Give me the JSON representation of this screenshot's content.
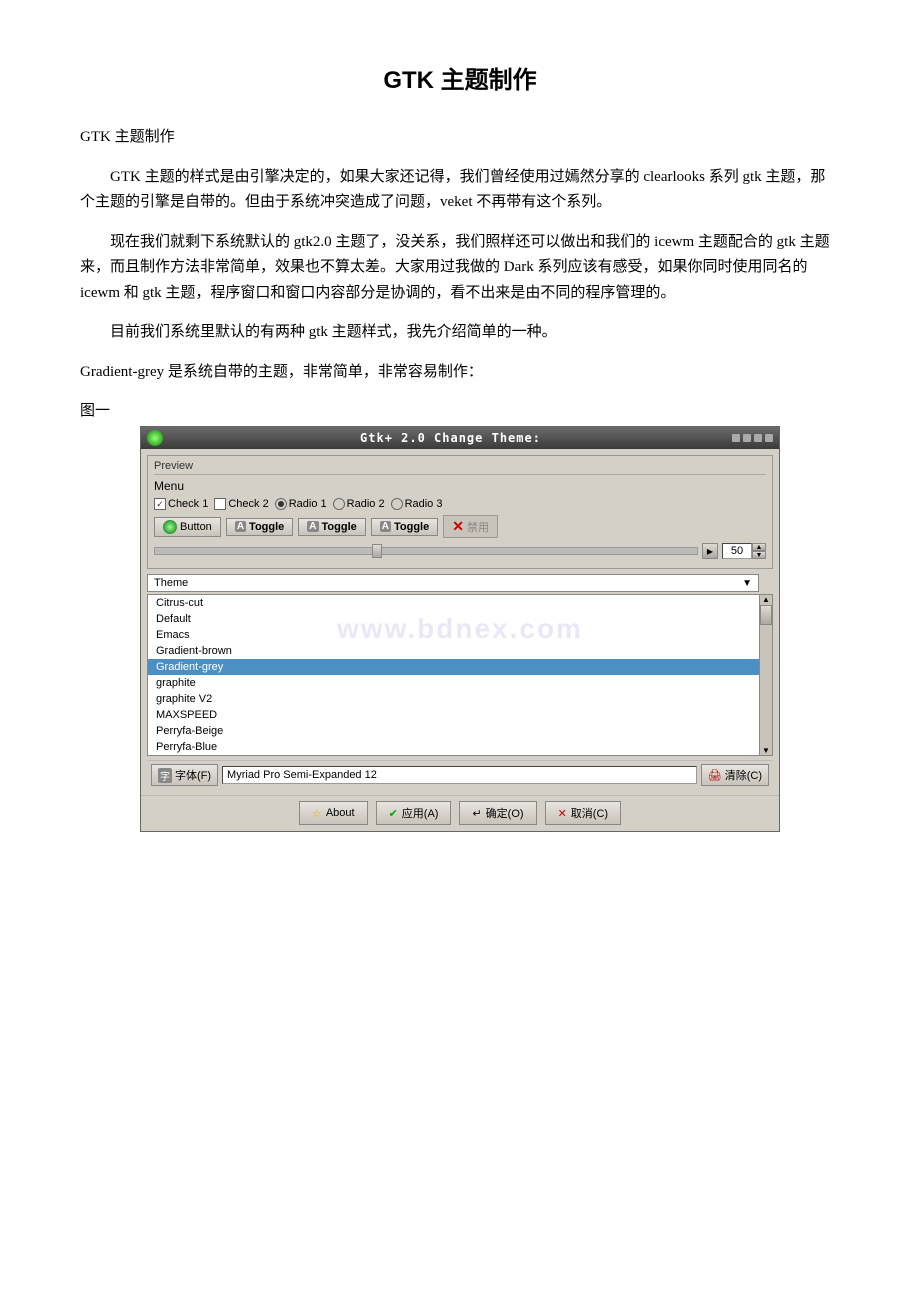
{
  "title": "GTK 主题制作",
  "intro_line": "GTK 主题制作",
  "para1": "GTK 主题的样式是由引擎决定的，如果大家还记得，我们曾经使用过嫣然分享的 clearlooks 系列 gtk 主题，那个主题的引擎是自带的。但由于系统冲突造成了问题，veket 不再带有这个系列。",
  "para2": "现在我们就剩下系统默认的 gtk2.0 主题了，没关系，我们照样还可以做出和我们的 icewm 主题配合的 gtk 主题来，而且制作方法非常简单，效果也不算太差。大家用过我做的 Dark 系列应该有感受，如果你同时使用同名的 icewm 和 gtk 主题，程序窗口和窗口内容部分是协调的，看不出来是由不同的程序管理的。",
  "para3": "目前我们系统里默认的有两种 gtk 主题样式，我先介绍简单的一种。",
  "para4": "Gradient-grey 是系统自带的主题，非常简单，非常容易制作：",
  "figure_label": "图一",
  "window": {
    "title": "Gtk+ 2.0 Change Theme:",
    "preview_label": "Preview",
    "menu_label": "Menu",
    "check1": "Check 1",
    "check2": "Check 2",
    "radio1": "Radio 1",
    "radio2": "Radio 2",
    "radio3": "Radio 3",
    "button_label": "Button",
    "toggle1": "Toggle",
    "toggle2": "Toggle",
    "toggle3": "Toggle",
    "disabled_label": "禁用",
    "slider_value": "50",
    "theme_dropdown_label": "Theme",
    "theme_items": [
      "Citrus-cut",
      "Default",
      "Emacs",
      "Gradient-brown",
      "Gradient-grey",
      "graphite",
      "graphite V2",
      "MAXSPEED",
      "Perryfa-Beige",
      "Perryfa-Blue"
    ],
    "selected_theme": "Gradient-grey",
    "font_btn_label": "字体(F)",
    "font_value": "Myriad Pro Semi-Expanded 12",
    "clear_label": "清除(C)",
    "about_label": "About",
    "apply_label": "应用(A)",
    "ok_label": "确定(O)",
    "cancel_label": "取消(C)"
  }
}
